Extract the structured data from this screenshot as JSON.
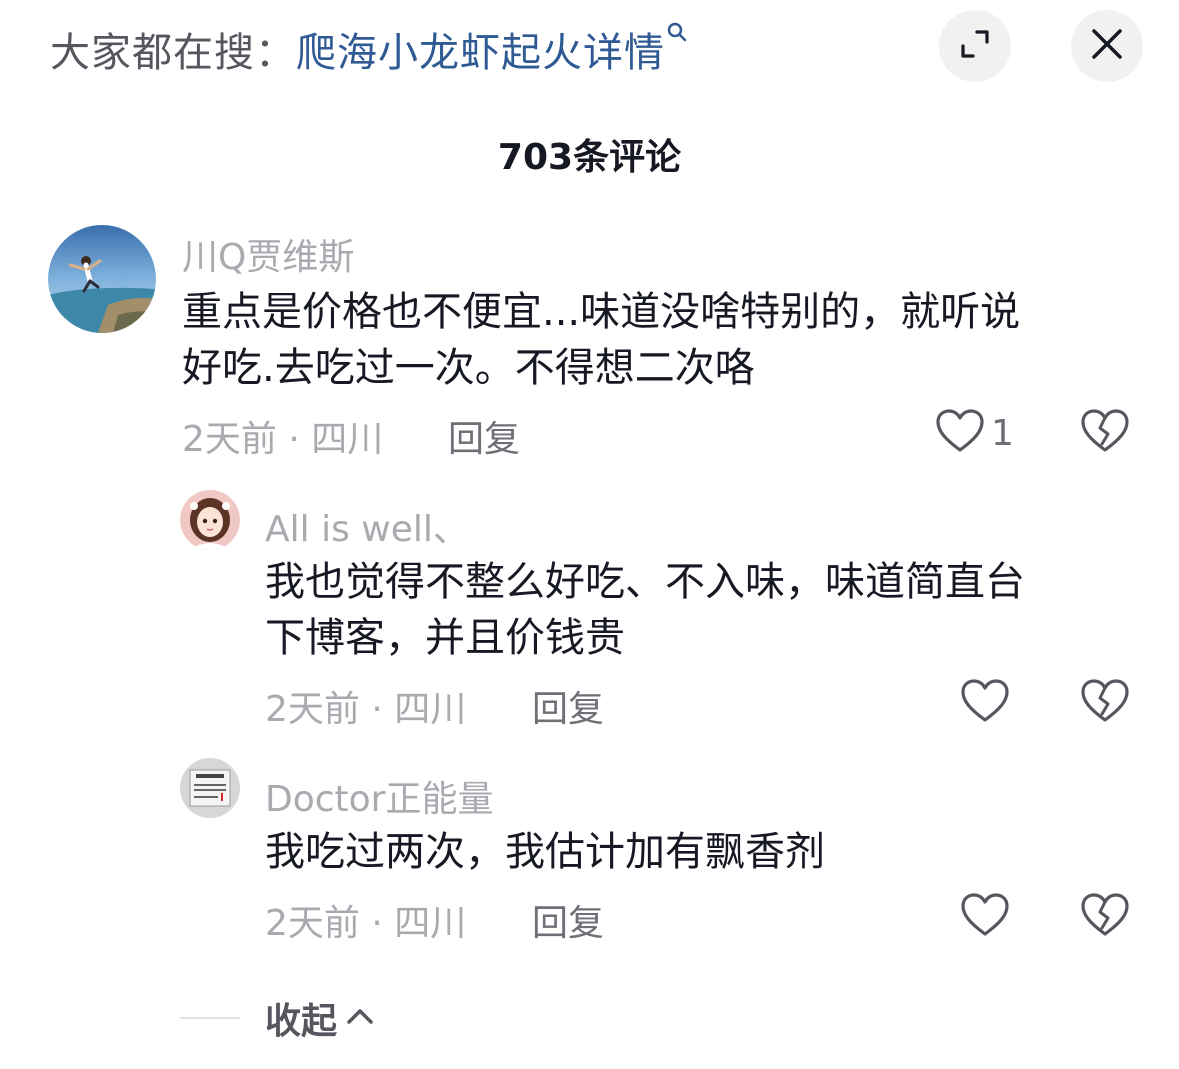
{
  "search": {
    "prefix": "大家都在搜：",
    "term": "爬海小龙虾起火详情"
  },
  "header": {
    "count_title": "703条评论",
    "buttons": [
      {
        "name": "expand-button",
        "icon": "expand-icon"
      },
      {
        "name": "close-button",
        "icon": "close-icon"
      }
    ]
  },
  "comments": [
    {
      "username": "川Q贾维斯",
      "content_lines": [
        "重点是价格也不便宜...味道没啥特别的，就听说",
        "好吃.去吃过一次。不得想二次咯"
      ],
      "time": "2天前 · 四川",
      "reply_label": "回复",
      "like_count": "1",
      "avatar": "beach-jump-avatar"
    },
    {
      "username": "All is well、",
      "content_lines": [
        "我也觉得不整么好吃、不入味，味道简直台",
        "下博客，并且价钱贵"
      ],
      "time": "2天前 · 四川",
      "reply_label": "回复",
      "like_count": "",
      "avatar": "cartoon-girl-avatar"
    },
    {
      "username": "Doctor正能量",
      "content_lines": [
        "我吃过两次，我估计加有飘香剂"
      ],
      "time": "2天前 · 四川",
      "reply_label": "回复",
      "like_count": "",
      "avatar": "sign-board-avatar"
    }
  ],
  "collapse": {
    "label": "收起"
  },
  "colors": {
    "link": "#2f5a93",
    "muted": "#a9aab0",
    "text": "#161823",
    "button_bg": "#f1f1f2"
  }
}
